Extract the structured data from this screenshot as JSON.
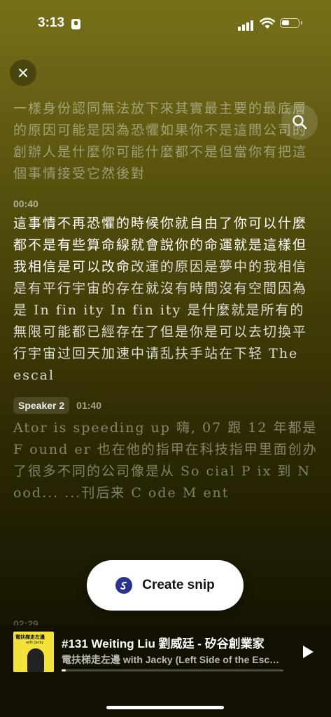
{
  "status": {
    "time": "3:13"
  },
  "icons": {
    "close": "close-icon",
    "search": "search-icon",
    "play": "play-icon",
    "snip": "snip-logo-icon"
  },
  "transcript": {
    "para1": "一樣身份認同無法放下來其實最主要的最底層的原因可能是因為恐懼如果你不是這間公司的創辦人是什麼你可能什麼都不是但當你有把這個事情接受它然後對",
    "seg2_time": "00:40",
    "para2_bright": "這事情不再恐懼的時候你就自由了你可以什麼都不是有些算命線就會說你的命運就是這樣但我相信是可以改命",
    "para2_dim": "改運的原因是夢中的我相信是有平行宇宙的存在就沒有時間沒有空間因為是 In fin ity In fin ity 是什麼就是所有的無限可能都已經存在了但是你是可以去切換平行宇宙过回天加速中请乱扶手站在下轻 The escal",
    "seg3_speaker": "Speaker 2",
    "seg3_time": "01:40",
    "para3": "Ator is speeding up 嗨, 07 跟 12 年都是 F ound er 也在他的指甲在科技指甲里面创办了很多不同的公司像是从 So cial P ix 到 N ood... ...刊后来 C ode M ent",
    "next_time": "02:29"
  },
  "snip": {
    "label": "Create snip"
  },
  "player": {
    "episode_title": "#131 Weiting Liu 劉威廷 - 矽谷創業家",
    "show_title": "電扶梯走左邊 with Jacky (Left Side of the Escalator)",
    "cover_title": "電扶梯走左邊",
    "cover_sub": "with Jacky",
    "progress": 0.02
  },
  "colors": {
    "bg_top": "#77701a",
    "bg_bottom": "#111001",
    "snip_logo": "#2a3490"
  }
}
